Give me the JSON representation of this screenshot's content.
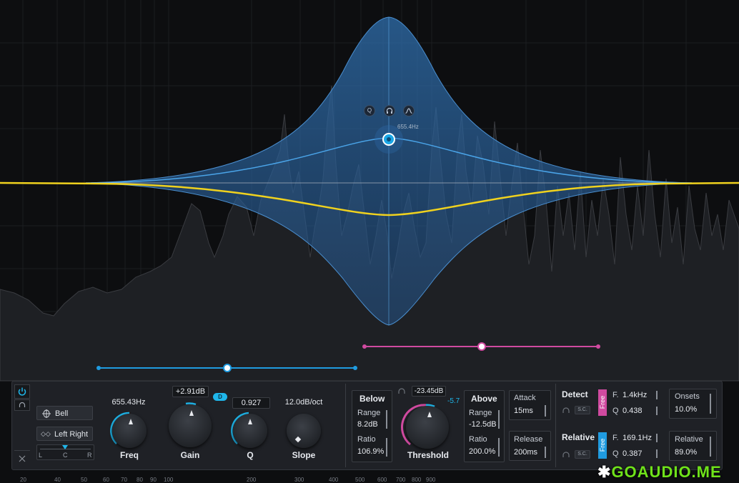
{
  "band": {
    "freq_readout": "655.4Hz",
    "handle_icons": [
      "Q",
      "headphones-icon",
      "bell-shape-icon"
    ]
  },
  "band_panel": {
    "shape": "Bell",
    "stereo": "Left Right",
    "pan_labels": {
      "left": "L",
      "center": "C",
      "right": "R"
    },
    "freq": {
      "value": "655.43Hz",
      "label": "Freq"
    },
    "gain": {
      "value": "+2.91dB",
      "label": "Gain",
      "badge": "D"
    },
    "q": {
      "value": "0.927",
      "label": "Q"
    },
    "slope": {
      "value": "12.0dB/oct",
      "label": "Slope"
    }
  },
  "dynamics": {
    "below": {
      "title": "Below",
      "range_label": "Range",
      "range_value": "8.2dB",
      "ratio_label": "Ratio",
      "ratio_value": "106.9%"
    },
    "threshold": {
      "value": "-23.45dB",
      "side_value": "-5.7",
      "label": "Threshold"
    },
    "above": {
      "title": "Above",
      "range_label": "Range",
      "range_value": "-12.5dB",
      "ratio_label": "Ratio",
      "ratio_value": "200.0%"
    },
    "attack": {
      "label": "Attack",
      "value": "15ms"
    },
    "release": {
      "label": "Release",
      "value": "200ms"
    }
  },
  "detect": {
    "title": "Detect",
    "mode": "Free",
    "sc": "S.C.",
    "f_label": "F.",
    "f_value": "1.4kHz",
    "q_label": "Q",
    "q_value": "0.438",
    "onsets_label": "Onsets",
    "onsets_value": "10.0%"
  },
  "relative": {
    "title": "Relative",
    "mode": "Free",
    "sc": "S.C.",
    "f_label": "F.",
    "f_value": "169.1Hz",
    "q_label": "Q",
    "q_value": "0.387",
    "rel_label": "Relative",
    "rel_value": "89.0%"
  },
  "freq_axis": [
    "20",
    "40",
    "50",
    "60",
    "70",
    "80",
    "90",
    "100",
    "200",
    "300",
    "400",
    "500",
    "600",
    "700",
    "800",
    "900"
  ],
  "watermark": "GOAUDIO.ME",
  "colors": {
    "accent": "#1fb6ea",
    "curve": "#f0d21e",
    "pink": "#d04aa0",
    "band_fill": "#2f74b8"
  }
}
